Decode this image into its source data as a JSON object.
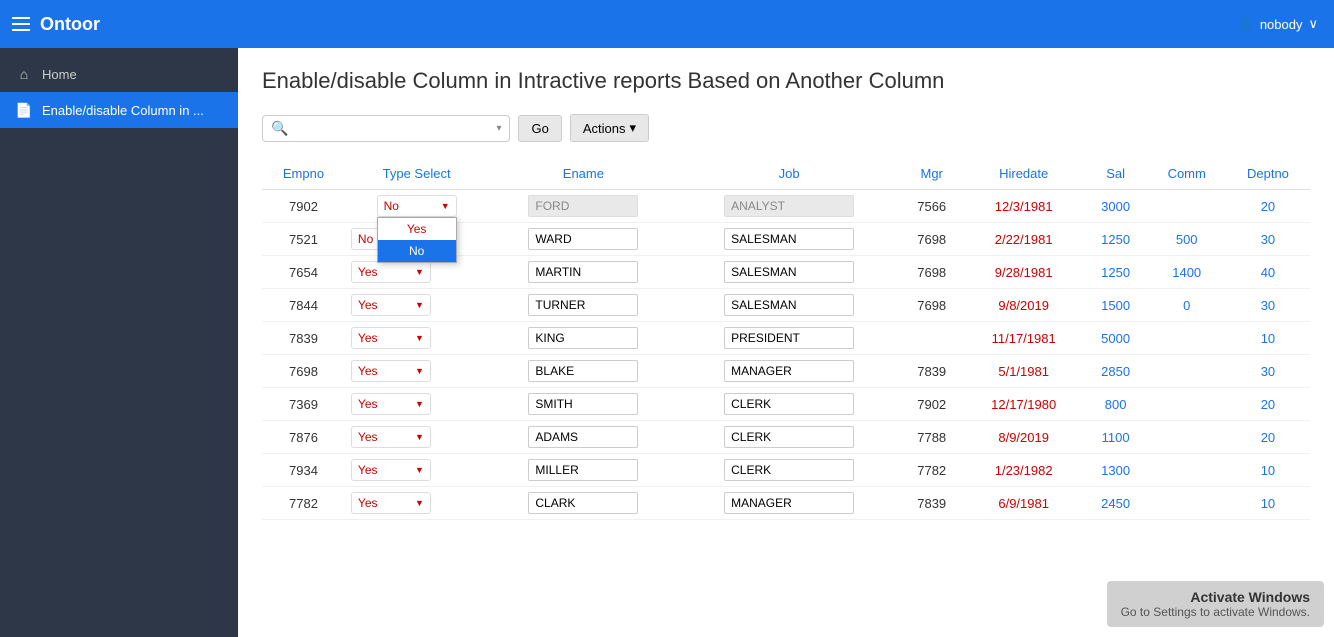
{
  "sidebar": {
    "brand": "Ontoor",
    "items": [
      {
        "id": "home",
        "label": "Home",
        "icon": "⌂",
        "active": false
      },
      {
        "id": "enable-disable",
        "label": "Enable/disable Column in ...",
        "icon": "📄",
        "active": true
      }
    ]
  },
  "topbar": {
    "user": "nobody",
    "chevron": "∨"
  },
  "page": {
    "title": "Enable/disable Column in Intractive reports Based on Another Column"
  },
  "toolbar": {
    "search_placeholder": "",
    "go_label": "Go",
    "actions_label": "Actions",
    "actions_chevron": "▾"
  },
  "table": {
    "columns": [
      "Empno",
      "Type Select",
      "Ename",
      "Job",
      "Mgr",
      "Hiredate",
      "Sal",
      "Comm",
      "Deptno"
    ],
    "rows": [
      {
        "empno": "7902",
        "type": "No",
        "type_open": true,
        "ename": "FORD",
        "ename_disabled": true,
        "job": "ANALYST",
        "job_disabled": true,
        "mgr": "7566",
        "hiredate": "12/3/1981",
        "sal": "3000",
        "comm": "",
        "deptno": "20"
      },
      {
        "empno": "7521",
        "type": "No",
        "type_open": false,
        "ename": "WARD",
        "ename_disabled": false,
        "job": "SALESMAN",
        "job_disabled": false,
        "mgr": "7698",
        "hiredate": "2/22/1981",
        "sal": "1250",
        "comm": "500",
        "deptno": "30"
      },
      {
        "empno": "7654",
        "type": "Yes",
        "type_open": false,
        "ename": "MARTIN",
        "ename_disabled": false,
        "job": "SALESMAN",
        "job_disabled": false,
        "mgr": "7698",
        "hiredate": "9/28/1981",
        "sal": "1250",
        "comm": "1400",
        "deptno": "40"
      },
      {
        "empno": "7844",
        "type": "Yes",
        "type_open": false,
        "ename": "TURNER",
        "ename_disabled": false,
        "job": "SALESMAN",
        "job_disabled": false,
        "mgr": "7698",
        "hiredate": "9/8/2019",
        "sal": "1500",
        "comm": "0",
        "deptno": "30"
      },
      {
        "empno": "7839",
        "type": "Yes",
        "type_open": false,
        "ename": "KING",
        "ename_disabled": false,
        "job": "PRESIDENT",
        "job_disabled": false,
        "mgr": "",
        "hiredate": "11/17/1981",
        "sal": "5000",
        "comm": "",
        "deptno": "10"
      },
      {
        "empno": "7698",
        "type": "Yes",
        "type_open": false,
        "ename": "BLAKE",
        "ename_disabled": false,
        "job": "MANAGER",
        "job_disabled": false,
        "mgr": "7839",
        "hiredate": "5/1/1981",
        "sal": "2850",
        "comm": "",
        "deptno": "30"
      },
      {
        "empno": "7369",
        "type": "Yes",
        "type_open": false,
        "ename": "SMITH",
        "ename_disabled": false,
        "job": "CLERK",
        "job_disabled": false,
        "mgr": "7902",
        "hiredate": "12/17/1980",
        "sal": "800",
        "comm": "",
        "deptno": "20"
      },
      {
        "empno": "7876",
        "type": "Yes",
        "type_open": false,
        "ename": "ADAMS",
        "ename_disabled": false,
        "job": "CLERK",
        "job_disabled": false,
        "mgr": "7788",
        "hiredate": "8/9/2019",
        "sal": "1100",
        "comm": "",
        "deptno": "20"
      },
      {
        "empno": "7934",
        "type": "Yes",
        "type_open": false,
        "ename": "MILLER",
        "ename_disabled": false,
        "job": "CLERK",
        "job_disabled": false,
        "mgr": "7782",
        "hiredate": "1/23/1982",
        "sal": "1300",
        "comm": "",
        "deptno": "10"
      },
      {
        "empno": "7782",
        "type": "Yes",
        "type_open": false,
        "ename": "CLARK",
        "ename_disabled": false,
        "job": "MANAGER",
        "job_disabled": false,
        "mgr": "7839",
        "hiredate": "6/9/1981",
        "sal": "2450",
        "comm": "",
        "deptno": "10"
      }
    ],
    "dropdown_options": [
      "Yes",
      "No"
    ]
  },
  "activation": {
    "title": "Activate Windows",
    "message": "Go to Settings to activate Windows."
  }
}
